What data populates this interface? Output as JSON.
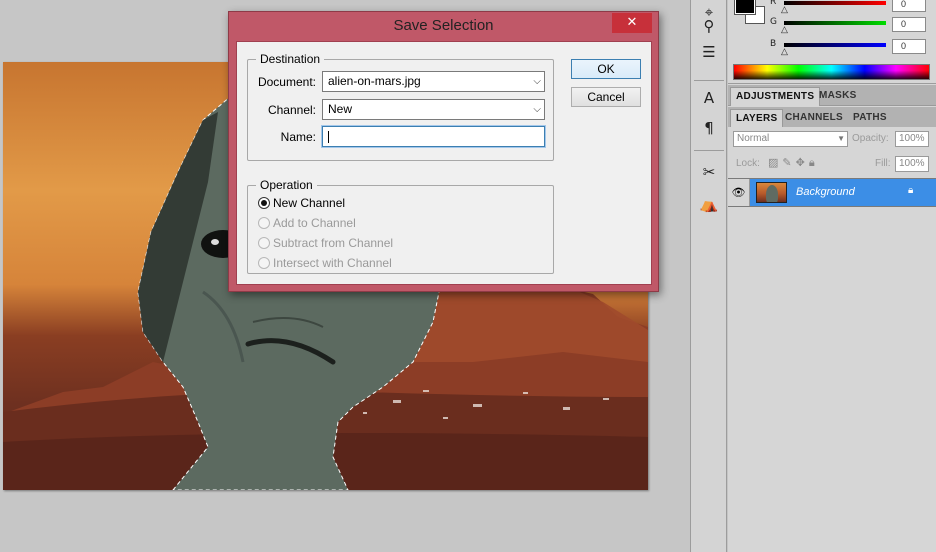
{
  "dialog": {
    "title": "Save Selection",
    "close_label": "✕",
    "destination": {
      "legend": "Destination",
      "document_label": "Document:",
      "document_value": "alien-on-mars.jpg",
      "channel_label": "Channel:",
      "channel_value": "New",
      "name_label": "Name:",
      "name_value": ""
    },
    "operation": {
      "legend": "Operation",
      "options": [
        {
          "label": "New Channel",
          "checked": true,
          "enabled": true
        },
        {
          "label": "Add to Channel",
          "checked": false,
          "enabled": false
        },
        {
          "label": "Subtract from Channel",
          "checked": false,
          "enabled": false
        },
        {
          "label": "Intersect with Channel",
          "checked": false,
          "enabled": false
        }
      ]
    },
    "ok_label": "OK",
    "cancel_label": "Cancel"
  },
  "color_panel": {
    "foreground": "#000000",
    "background": "#ffffff",
    "channels": [
      {
        "label": "R",
        "value": "0",
        "color": "#ff0000"
      },
      {
        "label": "G",
        "value": "0",
        "color": "#00dd00"
      },
      {
        "label": "B",
        "value": "0",
        "color": "#0000ff"
      }
    ]
  },
  "panel_tabs_top": [
    "ADJUSTMENTS",
    "MASKS"
  ],
  "panel_tabs_layers": [
    "LAYERS",
    "CHANNELS",
    "PATHS"
  ],
  "layers": {
    "blend_mode": "Normal",
    "opacity_label": "Opacity:",
    "opacity_value": "100%",
    "lock_label": "Lock:",
    "fill_label": "Fill:",
    "fill_value": "100%",
    "items": [
      {
        "name": "Background",
        "selected": true,
        "visible": true,
        "locked": true
      }
    ]
  },
  "tools": [
    "brush-tool-icon",
    "clone-stamp-icon",
    "history-brush-icon",
    "text-tool-icon",
    "paragraph-icon",
    "crop-tool-icon",
    "navigator-icon"
  ],
  "canvas": {
    "document": "alien-on-mars.jpg",
    "selection_active": true
  }
}
